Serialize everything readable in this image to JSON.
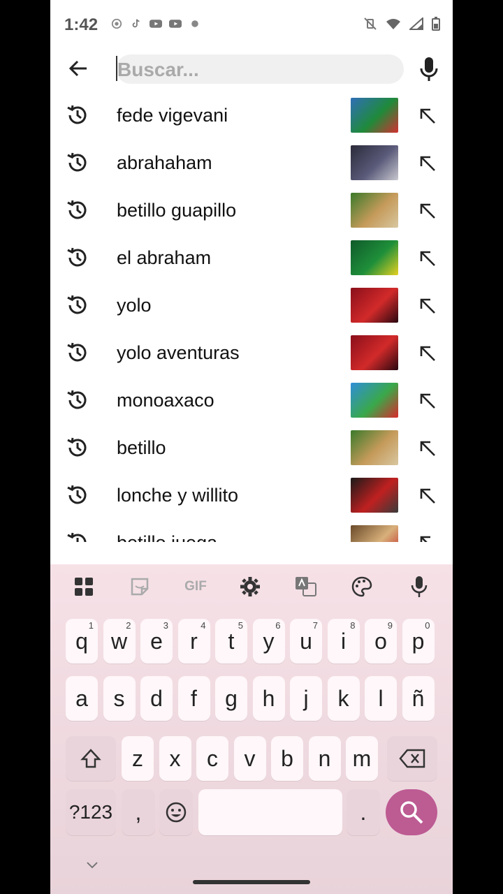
{
  "status_bar": {
    "time": "1:42"
  },
  "search": {
    "placeholder": "Buscar...",
    "value": ""
  },
  "history": [
    {
      "label": "fede vigevani",
      "thumb_colors": [
        "#2f6fb8",
        "#1f8a3a",
        "#d23030"
      ]
    },
    {
      "label": "abrahaham",
      "thumb_colors": [
        "#2b2b3a",
        "#5a5a7a",
        "#c8c8d0"
      ]
    },
    {
      "label": "betillo guapillo",
      "thumb_colors": [
        "#3a7a2a",
        "#c59a5a",
        "#d8c7a0"
      ]
    },
    {
      "label": "el abraham",
      "thumb_colors": [
        "#0f5a2a",
        "#1f8f3a",
        "#e6d020"
      ]
    },
    {
      "label": "yolo",
      "thumb_colors": [
        "#8a0f1a",
        "#d22a2a",
        "#2a0810"
      ]
    },
    {
      "label": "yolo aventuras",
      "thumb_colors": [
        "#8a0f1a",
        "#d22a2a",
        "#2a0810"
      ]
    },
    {
      "label": "monoaxaco",
      "thumb_colors": [
        "#2f8fd8",
        "#3aa84a",
        "#d82a2a"
      ]
    },
    {
      "label": "betillo",
      "thumb_colors": [
        "#3a7a2a",
        "#c59a5a",
        "#d8c7a0"
      ]
    },
    {
      "label": "lonche y willito",
      "thumb_colors": [
        "#1a1a1a",
        "#c02020",
        "#3a3a3a"
      ]
    },
    {
      "label": "betillo juega",
      "thumb_colors": [
        "#6a4a2a",
        "#d8b07a",
        "#c02020"
      ]
    }
  ],
  "keyboard": {
    "toolbar": [
      "apps-grid",
      "sticker",
      "GIF",
      "settings",
      "translate",
      "palette",
      "mic"
    ],
    "gif_label": "GIF",
    "row1": [
      {
        "k": "q",
        "h": "1"
      },
      {
        "k": "w",
        "h": "2"
      },
      {
        "k": "e",
        "h": "3"
      },
      {
        "k": "r",
        "h": "4"
      },
      {
        "k": "t",
        "h": "5"
      },
      {
        "k": "y",
        "h": "6"
      },
      {
        "k": "u",
        "h": "7"
      },
      {
        "k": "i",
        "h": "8"
      },
      {
        "k": "o",
        "h": "9"
      },
      {
        "k": "p",
        "h": "0"
      }
    ],
    "row2": [
      "a",
      "s",
      "d",
      "f",
      "g",
      "h",
      "j",
      "k",
      "l",
      "ñ"
    ],
    "row3": [
      "z",
      "x",
      "c",
      "v",
      "b",
      "n",
      "m"
    ],
    "symbols_label": "?123",
    "comma": ",",
    "period": "."
  },
  "colors": {
    "accent": "#bd5b93",
    "keyboard_bg": "#f6e1e7"
  }
}
